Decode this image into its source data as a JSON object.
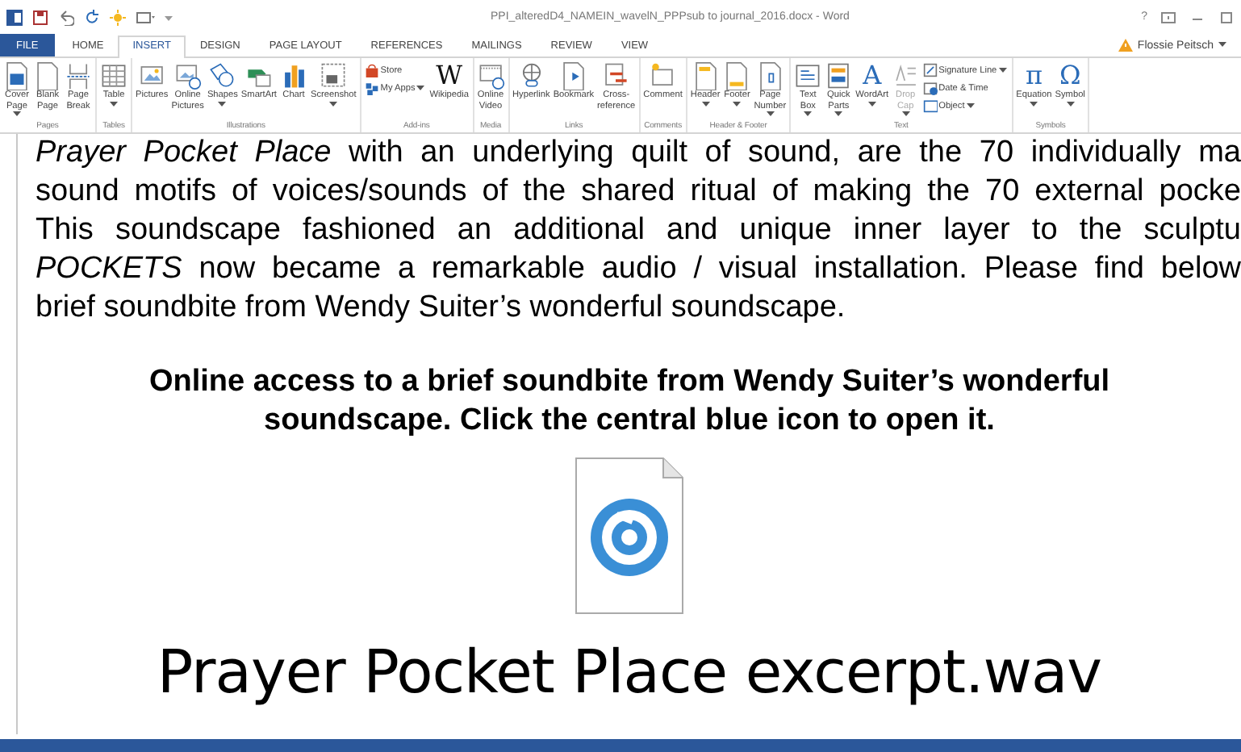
{
  "title_bar": {
    "title": "PPI_alteredD4_NAMEIN_wavelN_PPPsub to journal_2016.docx - Word",
    "help": "?",
    "user": "Flossie Peitsch"
  },
  "tabs": [
    {
      "label": "FILE",
      "kind": "file",
      "selected": false
    },
    {
      "label": "HOME",
      "kind": "tab",
      "selected": false
    },
    {
      "label": "INSERT",
      "kind": "tab",
      "selected": true
    },
    {
      "label": "DESIGN",
      "kind": "tab",
      "selected": false
    },
    {
      "label": "PAGE LAYOUT",
      "kind": "tab",
      "selected": false
    },
    {
      "label": "REFERENCES",
      "kind": "tab",
      "selected": false
    },
    {
      "label": "MAILINGS",
      "kind": "tab",
      "selected": false
    },
    {
      "label": "REVIEW",
      "kind": "tab",
      "selected": false
    },
    {
      "label": "VIEW",
      "kind": "tab",
      "selected": false
    }
  ],
  "ribbon": [
    {
      "label": "Pages",
      "buttons": [
        {
          "kind": "large",
          "label": "Cover\nPage",
          "dropdown": true
        },
        {
          "kind": "large",
          "label": "Blank\nPage",
          "dropdown": false
        },
        {
          "kind": "large",
          "label": "Page\nBreak",
          "dropdown": false
        }
      ]
    },
    {
      "label": "Tables",
      "buttons": [
        {
          "kind": "large",
          "label": "Table",
          "dropdown": true
        }
      ]
    },
    {
      "label": "Illustrations",
      "buttons": [
        {
          "kind": "large",
          "label": "Pictures",
          "dropdown": false
        },
        {
          "kind": "large",
          "label": "Online\nPictures",
          "dropdown": false
        },
        {
          "kind": "large",
          "label": "Shapes",
          "dropdown": true
        },
        {
          "kind": "large",
          "label": "SmartArt",
          "dropdown": false
        },
        {
          "kind": "large",
          "label": "Chart",
          "dropdown": false
        },
        {
          "kind": "large",
          "label": "Screenshot",
          "dropdown": true
        }
      ]
    },
    {
      "label": "Add-ins",
      "buttons": [
        {
          "kind": "stack",
          "items": [
            {
              "label": "Store",
              "dropdown": false
            },
            {
              "label": "My Apps",
              "dropdown": true
            }
          ]
        },
        {
          "kind": "glyph",
          "glyph": "W",
          "label": "Wikipedia",
          "dropdown": false
        }
      ]
    },
    {
      "label": "Media",
      "buttons": [
        {
          "kind": "large",
          "label": "Online\nVideo",
          "dropdown": false
        }
      ]
    },
    {
      "label": "Links",
      "buttons": [
        {
          "kind": "large",
          "label": "Hyperlink",
          "dropdown": false
        },
        {
          "kind": "large",
          "label": "Bookmark",
          "dropdown": false
        },
        {
          "kind": "large",
          "label": "Cross-\nreference",
          "dropdown": false
        }
      ]
    },
    {
      "label": "Comments",
      "buttons": [
        {
          "kind": "large",
          "label": "Comment",
          "dropdown": false
        }
      ]
    },
    {
      "label": "Header & Footer",
      "buttons": [
        {
          "kind": "large",
          "label": "Header",
          "dropdown": true
        },
        {
          "kind": "large",
          "label": "Footer",
          "dropdown": true
        },
        {
          "kind": "large",
          "label": "Page\nNumber",
          "dropdown": true
        }
      ]
    },
    {
      "label": "Text",
      "buttons": [
        {
          "kind": "large",
          "label": "Text\nBox",
          "dropdown": true
        },
        {
          "kind": "large",
          "label": "Quick\nParts",
          "dropdown": true
        },
        {
          "kind": "glyph",
          "glyph": "A",
          "label": "WordArt",
          "dropdown": true
        },
        {
          "kind": "large",
          "label": "Drop\nCap",
          "dropdown": true,
          "disabled": true
        },
        {
          "kind": "stack",
          "items": [
            {
              "label": "Signature Line",
              "dropdown": true
            },
            {
              "label": "Date & Time",
              "dropdown": false
            },
            {
              "label": "Object",
              "dropdown": true
            }
          ]
        }
      ]
    },
    {
      "label": "Symbols",
      "buttons": [
        {
          "kind": "glyph",
          "glyph": "π",
          "label": "Equation",
          "dropdown": true
        },
        {
          "kind": "glyph",
          "glyph": "Ω",
          "label": "Symbol",
          "dropdown": true
        }
      ]
    }
  ],
  "document": {
    "paragraph": [
      "*Prayer Pocket Place* with an underlying quilt of sound, are the 70 individually ma",
      "sound motifs of voices/sounds of the shared ritual of making the 70 external pocke",
      "This soundscape fashioned an additional and unique inner layer to the sculptu",
      "*POCKETS* now became a remarkable audio / visual installation. Please find below",
      "brief soundbite from Wendy Suiter’s wonderful soundscape."
    ],
    "caption": [
      "Online access to a brief soundbite from Wendy Suiter’s wonderful",
      "soundscape. Click the central blue icon to open it."
    ],
    "attachment": "Prayer Pocket Place excerpt.wav"
  }
}
